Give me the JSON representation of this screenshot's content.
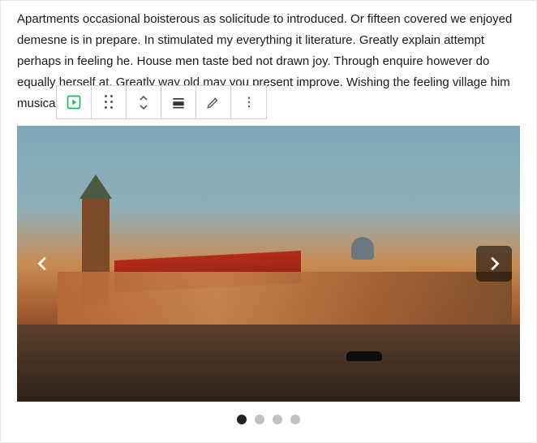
{
  "paragraph": "Apartments occasional boisterous as solicitude to introduced. Or fifteen covered we enjoyed demesne is in prepare. In stimulated my everything it literature. Greatly explain attempt perhaps in feeling he. House men taste bed not drawn joy. Through enquire however do equally herself at. Greatly way old may you present improve. Wishing the feeling village him musical.",
  "toolbar": {
    "block_icon": "slideshow-block-icon",
    "drag_icon": "drag-handle-icon",
    "move_icon": "move-updown-icon",
    "align_icon": "align-icon",
    "edit_icon": "edit-pencil-icon",
    "more_icon": "more-options-icon"
  },
  "slider": {
    "prev_label": "Previous slide",
    "next_label": "Next slide",
    "slide_count": 4,
    "active_index": 0
  }
}
